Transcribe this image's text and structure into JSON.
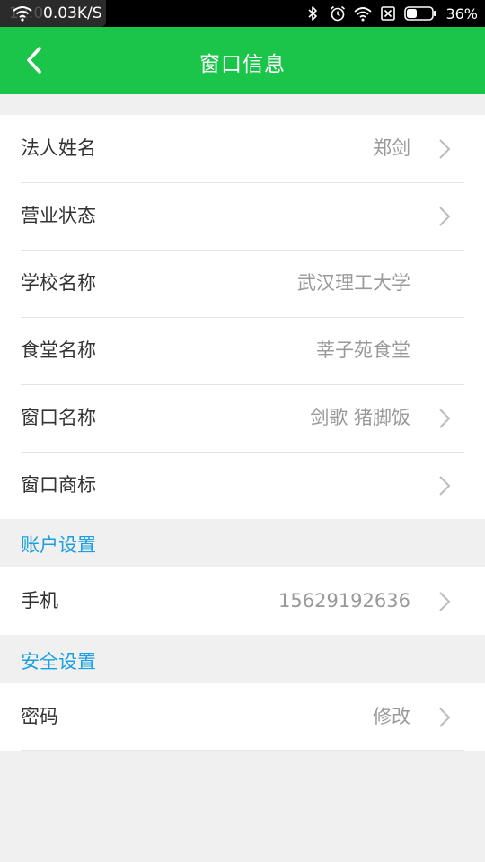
{
  "status_bar": {
    "time": "12:00",
    "net_speed": "0.03K/S",
    "battery_percent": "36%",
    "icons": [
      "wifi-icon",
      "bluetooth-icon",
      "alarm-icon",
      "wifi-icon",
      "sim-icon",
      "battery-icon"
    ]
  },
  "header": {
    "title": "窗口信息",
    "back_icon": "back-chevron-icon",
    "color": "#1ac54a"
  },
  "window_info": {
    "rows": [
      {
        "label": "法人姓名",
        "value": "郑剑",
        "chevron": true
      },
      {
        "label": "营业状态",
        "value": "",
        "chevron": true
      },
      {
        "label": "学校名称",
        "value": "武汉理工大学",
        "chevron": false
      },
      {
        "label": "食堂名称",
        "value": "莘子苑食堂",
        "chevron": false
      },
      {
        "label": "窗口名称",
        "value": "剑歌 猪脚饭",
        "chevron": true
      },
      {
        "label": "窗口商标",
        "value": "",
        "chevron": true
      }
    ]
  },
  "account_settings": {
    "title": "账户设置",
    "rows": [
      {
        "label": "手机",
        "value": "15629192636",
        "chevron": true
      }
    ]
  },
  "security_settings": {
    "title": "安全设置",
    "rows": [
      {
        "label": "密码",
        "value": "修改",
        "chevron": true
      }
    ]
  },
  "colors": {
    "accent": "#1ac54a",
    "section_title": "#1a9fe0",
    "label": "#333333",
    "value": "#999999",
    "background": "#f0f0f0"
  }
}
